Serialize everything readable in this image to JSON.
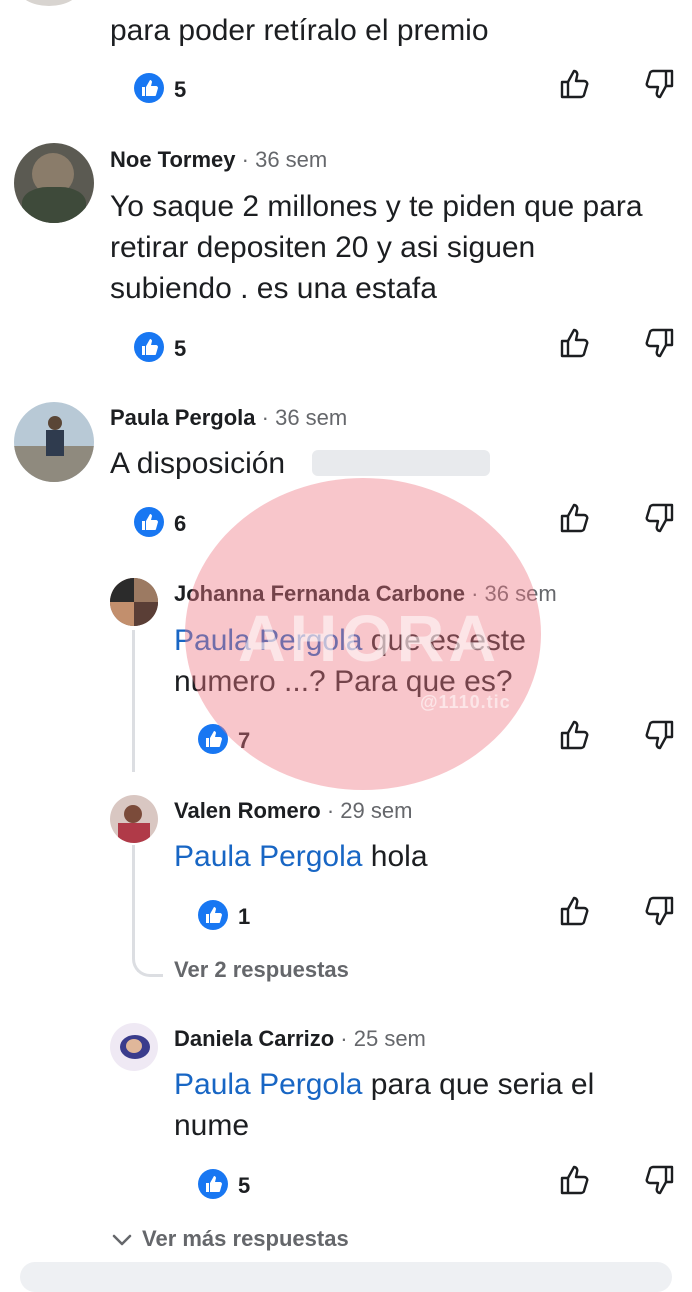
{
  "comments": [
    {
      "id": "c0",
      "text": "para poder retíralo el premio",
      "likes": "5"
    },
    {
      "id": "c1",
      "author": "Noe Tormey",
      "time": "· 36 sem",
      "lines": [
        "Yo saque 2 millones y te piden que para",
        "retirar depositen 20 y asi siguen",
        "subiendo . es una estafa"
      ],
      "likes": "5"
    },
    {
      "id": "c2",
      "author": "Paula Pergola",
      "time": "· 36 sem",
      "text": "A disposición",
      "likes": "6",
      "replies": [
        {
          "author": "Johanna Fernanda Carbone",
          "time": "· 36 sem",
          "mention": "Paula Pergola",
          "line1": " que es este",
          "line2": "numero ...? Para que es?",
          "likes": "7"
        },
        {
          "author": "Valen Romero",
          "time": "· 29 sem",
          "mention": "Paula Pergola",
          "line1": " hola",
          "likes": "1"
        }
      ],
      "more_replies_link": "Ver 2 respuestas"
    },
    {
      "id": "c3",
      "author": "Daniela Carrizo",
      "time": "· 25 sem",
      "mention": "Paula Pergola",
      "line1": " para que seria el",
      "line2": "nume",
      "likes": "5"
    }
  ],
  "view_more_link": "Ver más respuestas",
  "watermark": {
    "text": "AHORA",
    "subtext": "@1110.tic"
  },
  "colors": {
    "accent": "#1877f2",
    "mention": "#1866c4",
    "secondary_text": "#65676b"
  },
  "icons": {
    "like": "like-filled-icon",
    "thumb_up": "thumb-up-outline-icon",
    "thumb_down": "thumb-down-outline-icon"
  }
}
